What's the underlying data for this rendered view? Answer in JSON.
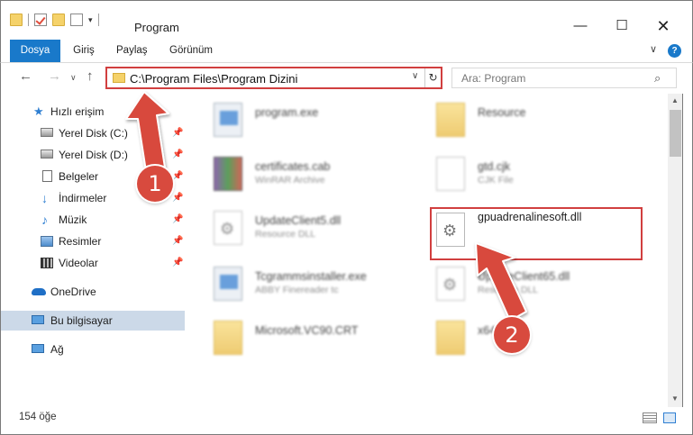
{
  "window": {
    "title": "Program",
    "minimize_glyph": "—",
    "maximize_glyph": "☐",
    "close_glyph": "✕"
  },
  "ribbon": {
    "tabs": [
      "Dosya",
      "Giriş",
      "Paylaş",
      "Görünüm"
    ],
    "help_glyph": "?",
    "collapse_glyph": "∨"
  },
  "address": {
    "back_glyph": "←",
    "forward_glyph": "→",
    "recent_glyph": "∨",
    "up_glyph": "↑",
    "path": "C:\\Program Files\\Program Dizini",
    "dropdown_glyph": "∨",
    "refresh_glyph": "↻"
  },
  "search": {
    "placeholder": "Ara: Program",
    "icon_glyph": "⌕"
  },
  "sidebar": {
    "items": [
      {
        "label": "Hızlı erişim"
      },
      {
        "label": "Yerel Disk (C:)"
      },
      {
        "label": "Yerel Disk (D:)"
      },
      {
        "label": "Belgeler"
      },
      {
        "label": "İndirmeler"
      },
      {
        "label": "Müzik"
      },
      {
        "label": "Resimler"
      },
      {
        "label": "Videolar"
      },
      {
        "label": "OneDrive"
      },
      {
        "label": "Bu bilgisayar"
      },
      {
        "label": "Ağ"
      }
    ],
    "pin_glyph": "📌",
    "star_glyph": "★",
    "down_glyph": "↓",
    "music_glyph": "♪"
  },
  "files": [
    {
      "name": "program.exe",
      "type": ""
    },
    {
      "name": "Resource",
      "type": ""
    },
    {
      "name": "certificates.cab",
      "type": "WinRAR Archive"
    },
    {
      "name": "gtd.cjk",
      "type": "CJK File"
    },
    {
      "name": "UpdateClient5.dll",
      "type": "Resource DLL"
    },
    {
      "name": "gpuadrenalinesoft.dll",
      "type": ""
    },
    {
      "name": "Tcgrammsinstaller.exe",
      "type": "ABBY Finereader tc"
    },
    {
      "name": "UpdateClient65.dll",
      "type": "Resource DLL"
    },
    {
      "name": "Microsoft.VC90.CRT",
      "type": ""
    },
    {
      "name": "x64",
      "type": ""
    }
  ],
  "scrollbar": {
    "up_glyph": "▲",
    "down_glyph": "▼"
  },
  "status": {
    "item_count": "154 öğe"
  },
  "annotations": {
    "badge1": "1",
    "badge2": "2",
    "color": "#d84a3e"
  },
  "colors": {
    "accent": "#1979ca",
    "highlight": "#d13f3f",
    "selected": "#ccd9e8"
  }
}
